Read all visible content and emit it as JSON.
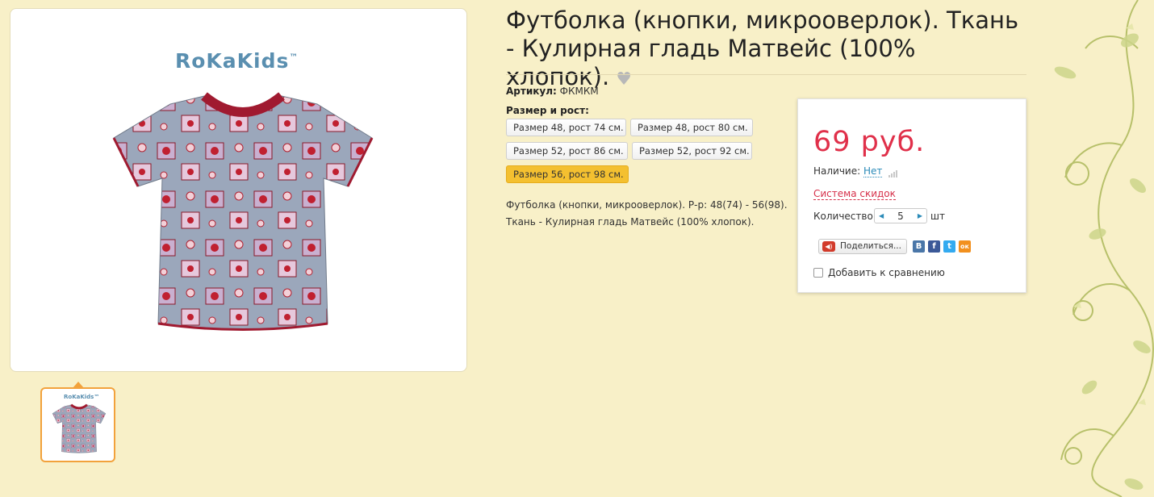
{
  "product": {
    "brand": "RoKaKids",
    "brand_tm": "™",
    "title": "Футболка (кнопки, микрооверлок). Ткань - Кулирная гладь Матвейс (100% хлопок).",
    "sku_label": "Артикул:",
    "sku_value": "ФКМКМ",
    "sizes_label": "Размер и рост:",
    "sizes": [
      {
        "label": "Размер 48, рост 74 см.",
        "active": false
      },
      {
        "label": "Размер 48, рост 80 см.",
        "active": false
      },
      {
        "label": "Размер 52, рост 86 см.",
        "active": false
      },
      {
        "label": "Размер 52, рост 92 см.",
        "active": false
      },
      {
        "label": "Размер 56, рост 98 см.",
        "active": true
      }
    ],
    "description_line1": "Футболка (кнопки, микрооверлок). Р-р: 48(74) - 56(98).",
    "description_line2": "Ткань - Кулирная гладь Матвейс (100% хлопок)."
  },
  "buy": {
    "price": "69 руб.",
    "stock_label": "Наличие:",
    "stock_value": "Нет",
    "discounts": "Система скидок",
    "qty_label": "Количество:",
    "qty_value": "5",
    "qty_unit": "шт",
    "share_label": "Поделиться...",
    "social": [
      "В",
      "f",
      "t",
      "ок"
    ],
    "compare_label": "Добавить к сравнению"
  },
  "colors": {
    "background": "#f8f0c8",
    "price": "#e0304a",
    "active_size": "#f4c030",
    "thumb_border": "#f2a23c",
    "link": "#2a8ab8"
  },
  "icons": {
    "favorite": "heart-icon",
    "qty_decrease": "chevron-left-icon",
    "qty_increase": "chevron-right-icon",
    "stock_bars": "signal-bars-icon"
  }
}
